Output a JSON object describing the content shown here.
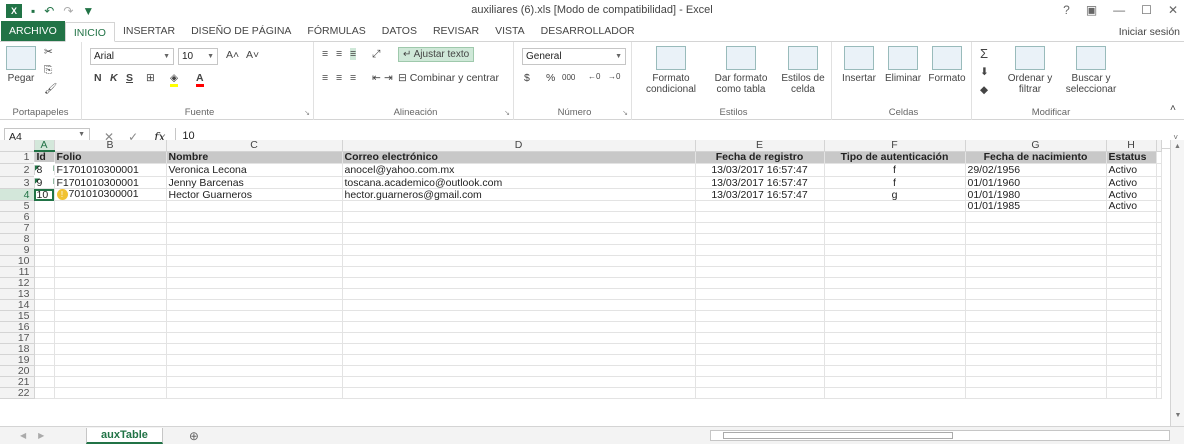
{
  "window": {
    "title": "auxiliares (6).xls  [Modo de compatibilidad] - Excel",
    "help": "?",
    "controls": [
      "▣",
      "—",
      "☐",
      "✕"
    ]
  },
  "ribbon_tabs": [
    "ARCHIVO",
    "INICIO",
    "INSERTAR",
    "DISEÑO DE PÁGINA",
    "FÓRMULAS",
    "DATOS",
    "REVISAR",
    "VISTA",
    "DESARROLLADOR"
  ],
  "signin": "Iniciar sesión",
  "clipboard": {
    "paste": "Pegar",
    "label": "Portapapeles"
  },
  "font": {
    "name": "Arial",
    "size": "10",
    "bold": "N",
    "italic": "K",
    "underline": "S",
    "label": "Fuente"
  },
  "alignment": {
    "wrap": "Ajustar texto",
    "merge": "Combinar y centrar",
    "label": "Alineación"
  },
  "number": {
    "format": "General",
    "currency": "$",
    "percent": "%",
    "thousands": "000",
    "label": "Número"
  },
  "styles": {
    "conditional": "Formato condicional",
    "table": "Dar formato como tabla",
    "cell": "Estilos de celda",
    "label": "Estilos"
  },
  "cells": {
    "insert": "Insertar",
    "delete": "Eliminar",
    "format": "Formato",
    "label": "Celdas"
  },
  "editing": {
    "sort": "Ordenar y filtrar",
    "find": "Buscar y seleccionar",
    "label": "Modificar"
  },
  "formula": {
    "namebox": "A4",
    "value": "10",
    "fx": "fx"
  },
  "columns": [
    "A",
    "B",
    "C",
    "D",
    "E",
    "F",
    "G",
    "H"
  ],
  "headers": [
    "Id",
    "Folio",
    "Nombre",
    "Correo electrónico",
    "Fecha de registro",
    "Tipo de autenticación",
    "Fecha de nacimiento",
    "Estatus"
  ],
  "rows": [
    [
      "8",
      "F1701010300001",
      "Veronica  Lecona",
      "anocel@yahoo.com.mx",
      "13/03/2017 16:57:47",
      "f",
      "29/02/1956",
      "Activo"
    ],
    [
      "9",
      "F1701010300001",
      "Jenny Barcenas",
      "toscana.academico@outlook.com",
      "13/03/2017 16:57:47",
      "f",
      "01/01/1960",
      "Activo"
    ],
    [
      "10",
      "701010300001",
      "Hector Guarneros",
      "hector.guarneros@gmail.com",
      "13/03/2017 16:57:47",
      "g",
      "01/01/1980",
      "Activo"
    ],
    [
      "",
      "",
      "",
      "",
      "",
      "",
      "01/01/1985",
      "Activo"
    ]
  ],
  "row_numbers": [
    "1",
    "2",
    "3",
    "4",
    "5",
    "6",
    "7",
    "8",
    "9",
    "10",
    "11",
    "12",
    "13",
    "14",
    "15",
    "16",
    "17",
    "18",
    "19",
    "20",
    "21",
    "22"
  ],
  "sheet_tab": "auxTable"
}
